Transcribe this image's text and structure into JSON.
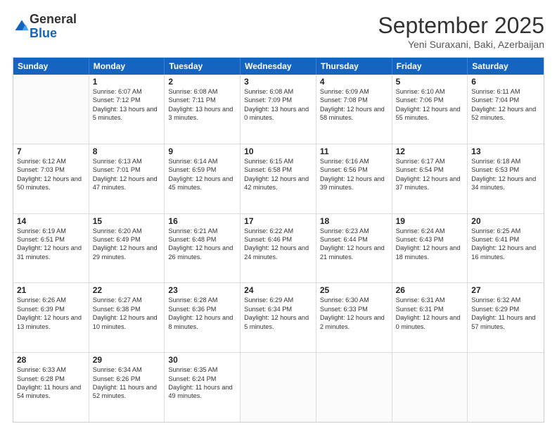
{
  "logo": {
    "general": "General",
    "blue": "Blue"
  },
  "header": {
    "month": "September 2025",
    "location": "Yeni Suraxani, Baki, Azerbaijan"
  },
  "weekdays": [
    "Sunday",
    "Monday",
    "Tuesday",
    "Wednesday",
    "Thursday",
    "Friday",
    "Saturday"
  ],
  "weeks": [
    [
      {
        "day": "",
        "sunrise": "",
        "sunset": "",
        "daylight": ""
      },
      {
        "day": "1",
        "sunrise": "Sunrise: 6:07 AM",
        "sunset": "Sunset: 7:12 PM",
        "daylight": "Daylight: 13 hours and 5 minutes."
      },
      {
        "day": "2",
        "sunrise": "Sunrise: 6:08 AM",
        "sunset": "Sunset: 7:11 PM",
        "daylight": "Daylight: 13 hours and 3 minutes."
      },
      {
        "day": "3",
        "sunrise": "Sunrise: 6:08 AM",
        "sunset": "Sunset: 7:09 PM",
        "daylight": "Daylight: 13 hours and 0 minutes."
      },
      {
        "day": "4",
        "sunrise": "Sunrise: 6:09 AM",
        "sunset": "Sunset: 7:08 PM",
        "daylight": "Daylight: 12 hours and 58 minutes."
      },
      {
        "day": "5",
        "sunrise": "Sunrise: 6:10 AM",
        "sunset": "Sunset: 7:06 PM",
        "daylight": "Daylight: 12 hours and 55 minutes."
      },
      {
        "day": "6",
        "sunrise": "Sunrise: 6:11 AM",
        "sunset": "Sunset: 7:04 PM",
        "daylight": "Daylight: 12 hours and 52 minutes."
      }
    ],
    [
      {
        "day": "7",
        "sunrise": "Sunrise: 6:12 AM",
        "sunset": "Sunset: 7:03 PM",
        "daylight": "Daylight: 12 hours and 50 minutes."
      },
      {
        "day": "8",
        "sunrise": "Sunrise: 6:13 AM",
        "sunset": "Sunset: 7:01 PM",
        "daylight": "Daylight: 12 hours and 47 minutes."
      },
      {
        "day": "9",
        "sunrise": "Sunrise: 6:14 AM",
        "sunset": "Sunset: 6:59 PM",
        "daylight": "Daylight: 12 hours and 45 minutes."
      },
      {
        "day": "10",
        "sunrise": "Sunrise: 6:15 AM",
        "sunset": "Sunset: 6:58 PM",
        "daylight": "Daylight: 12 hours and 42 minutes."
      },
      {
        "day": "11",
        "sunrise": "Sunrise: 6:16 AM",
        "sunset": "Sunset: 6:56 PM",
        "daylight": "Daylight: 12 hours and 39 minutes."
      },
      {
        "day": "12",
        "sunrise": "Sunrise: 6:17 AM",
        "sunset": "Sunset: 6:54 PM",
        "daylight": "Daylight: 12 hours and 37 minutes."
      },
      {
        "day": "13",
        "sunrise": "Sunrise: 6:18 AM",
        "sunset": "Sunset: 6:53 PM",
        "daylight": "Daylight: 12 hours and 34 minutes."
      }
    ],
    [
      {
        "day": "14",
        "sunrise": "Sunrise: 6:19 AM",
        "sunset": "Sunset: 6:51 PM",
        "daylight": "Daylight: 12 hours and 31 minutes."
      },
      {
        "day": "15",
        "sunrise": "Sunrise: 6:20 AM",
        "sunset": "Sunset: 6:49 PM",
        "daylight": "Daylight: 12 hours and 29 minutes."
      },
      {
        "day": "16",
        "sunrise": "Sunrise: 6:21 AM",
        "sunset": "Sunset: 6:48 PM",
        "daylight": "Daylight: 12 hours and 26 minutes."
      },
      {
        "day": "17",
        "sunrise": "Sunrise: 6:22 AM",
        "sunset": "Sunset: 6:46 PM",
        "daylight": "Daylight: 12 hours and 24 minutes."
      },
      {
        "day": "18",
        "sunrise": "Sunrise: 6:23 AM",
        "sunset": "Sunset: 6:44 PM",
        "daylight": "Daylight: 12 hours and 21 minutes."
      },
      {
        "day": "19",
        "sunrise": "Sunrise: 6:24 AM",
        "sunset": "Sunset: 6:43 PM",
        "daylight": "Daylight: 12 hours and 18 minutes."
      },
      {
        "day": "20",
        "sunrise": "Sunrise: 6:25 AM",
        "sunset": "Sunset: 6:41 PM",
        "daylight": "Daylight: 12 hours and 16 minutes."
      }
    ],
    [
      {
        "day": "21",
        "sunrise": "Sunrise: 6:26 AM",
        "sunset": "Sunset: 6:39 PM",
        "daylight": "Daylight: 12 hours and 13 minutes."
      },
      {
        "day": "22",
        "sunrise": "Sunrise: 6:27 AM",
        "sunset": "Sunset: 6:38 PM",
        "daylight": "Daylight: 12 hours and 10 minutes."
      },
      {
        "day": "23",
        "sunrise": "Sunrise: 6:28 AM",
        "sunset": "Sunset: 6:36 PM",
        "daylight": "Daylight: 12 hours and 8 minutes."
      },
      {
        "day": "24",
        "sunrise": "Sunrise: 6:29 AM",
        "sunset": "Sunset: 6:34 PM",
        "daylight": "Daylight: 12 hours and 5 minutes."
      },
      {
        "day": "25",
        "sunrise": "Sunrise: 6:30 AM",
        "sunset": "Sunset: 6:33 PM",
        "daylight": "Daylight: 12 hours and 2 minutes."
      },
      {
        "day": "26",
        "sunrise": "Sunrise: 6:31 AM",
        "sunset": "Sunset: 6:31 PM",
        "daylight": "Daylight: 12 hours and 0 minutes."
      },
      {
        "day": "27",
        "sunrise": "Sunrise: 6:32 AM",
        "sunset": "Sunset: 6:29 PM",
        "daylight": "Daylight: 11 hours and 57 minutes."
      }
    ],
    [
      {
        "day": "28",
        "sunrise": "Sunrise: 6:33 AM",
        "sunset": "Sunset: 6:28 PM",
        "daylight": "Daylight: 11 hours and 54 minutes."
      },
      {
        "day": "29",
        "sunrise": "Sunrise: 6:34 AM",
        "sunset": "Sunset: 6:26 PM",
        "daylight": "Daylight: 11 hours and 52 minutes."
      },
      {
        "day": "30",
        "sunrise": "Sunrise: 6:35 AM",
        "sunset": "Sunset: 6:24 PM",
        "daylight": "Daylight: 11 hours and 49 minutes."
      },
      {
        "day": "",
        "sunrise": "",
        "sunset": "",
        "daylight": ""
      },
      {
        "day": "",
        "sunrise": "",
        "sunset": "",
        "daylight": ""
      },
      {
        "day": "",
        "sunrise": "",
        "sunset": "",
        "daylight": ""
      },
      {
        "day": "",
        "sunrise": "",
        "sunset": "",
        "daylight": ""
      }
    ]
  ]
}
